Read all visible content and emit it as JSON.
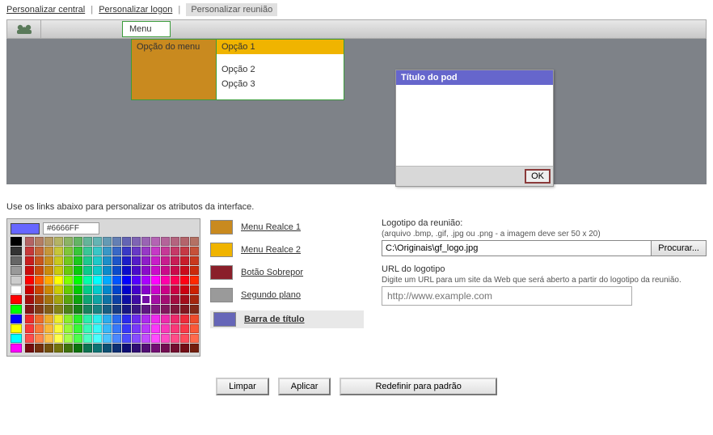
{
  "tabs": {
    "central": "Personalizar central",
    "logon": "Personalizar logon",
    "meeting": "Personalizar reunião"
  },
  "toolbar": {
    "menu": "Menu"
  },
  "menu_preview": {
    "option_label": "Opção do menu",
    "opts": [
      "Opção 1",
      "Opção 2",
      "Opção 3"
    ]
  },
  "pod": {
    "title": "Título do pod",
    "ok": "OK"
  },
  "instructions": "Use os links abaixo para personalizar os atributos da interface.",
  "picker": {
    "hex": "#6666FF"
  },
  "legend": {
    "items": [
      {
        "color": "#c98a1f",
        "label": "Menu Realce 1"
      },
      {
        "color": "#f0b400",
        "label": "Menu Realce 2"
      },
      {
        "color": "#8a1f2a",
        "label": "Botão Sobrepor"
      },
      {
        "color": "#9a9a9a",
        "label": "Segundo plano"
      },
      {
        "color": "#6666b8",
        "label": "Barra de título"
      }
    ]
  },
  "logo": {
    "label": "Logotipo da reunião:",
    "hint": "(arquivo .bmp, .gif, .jpg ou .png - a imagem deve ser 50 x 20)",
    "path": "C:\\Originais\\gf_logo.jpg",
    "browse": "Procurar..."
  },
  "url": {
    "label": "URL do logotipo",
    "hint": "Digite um URL para um site da Web que será aberto a partir do logotipo da reunião.",
    "placeholder": "http://www.example.com"
  },
  "buttons": {
    "clear": "Limpar",
    "apply": "Aplicar",
    "reset": "Redefinir para padrão"
  },
  "palette_left": [
    "#000000",
    "#333333",
    "#666666",
    "#999999",
    "#cccccc",
    "#ffffff",
    "#ff0000",
    "#00ff00",
    "#0000ff",
    "#ffff00",
    "#00ffff",
    "#ff00ff"
  ],
  "palette": {
    "hues": [
      0,
      20,
      40,
      60,
      90,
      120,
      160,
      180,
      200,
      220,
      240,
      260,
      280,
      300,
      320,
      340,
      355,
      10
    ],
    "rows": [
      {
        "s": 35,
        "l": 55
      },
      {
        "s": 55,
        "l": 50
      },
      {
        "s": 75,
        "l": 45
      },
      {
        "s": 90,
        "l": 42
      },
      {
        "s": 100,
        "l": 50
      },
      {
        "s": 100,
        "l": 40
      },
      {
        "s": 85,
        "l": 35
      },
      {
        "s": 70,
        "l": 30
      },
      {
        "s": 85,
        "l": 55
      },
      {
        "s": 95,
        "l": 60
      },
      {
        "s": 100,
        "l": 65
      },
      {
        "s": 80,
        "l": 25
      }
    ],
    "selected": {
      "row": 6,
      "col": 12
    }
  }
}
